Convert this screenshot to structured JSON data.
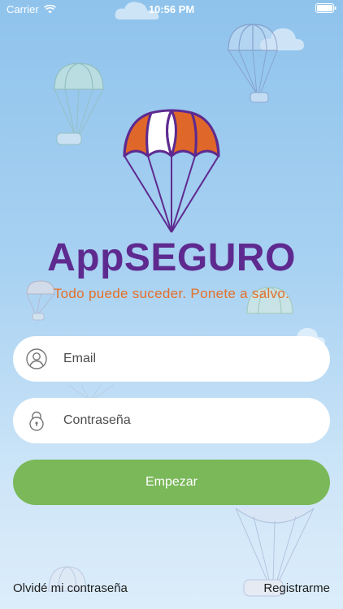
{
  "status_bar": {
    "carrier": "Carrier",
    "time": "10:56 PM"
  },
  "brand": {
    "name": "AppSEGURO",
    "tagline": "Todo puede suceder. Ponete a salvo.",
    "colors": {
      "primary": "#5e2a8f",
      "accent": "#e4702b",
      "button": "#7ab85a"
    }
  },
  "form": {
    "email_placeholder": "Email",
    "password_placeholder": "Contraseña",
    "submit_label": "Empezar"
  },
  "links": {
    "forgot_password": "Olvidé mi contraseña",
    "register": "Registrarme"
  },
  "icons": {
    "email": "user-icon",
    "password": "lock-icon",
    "wifi": "wifi-icon",
    "battery": "battery-icon"
  }
}
